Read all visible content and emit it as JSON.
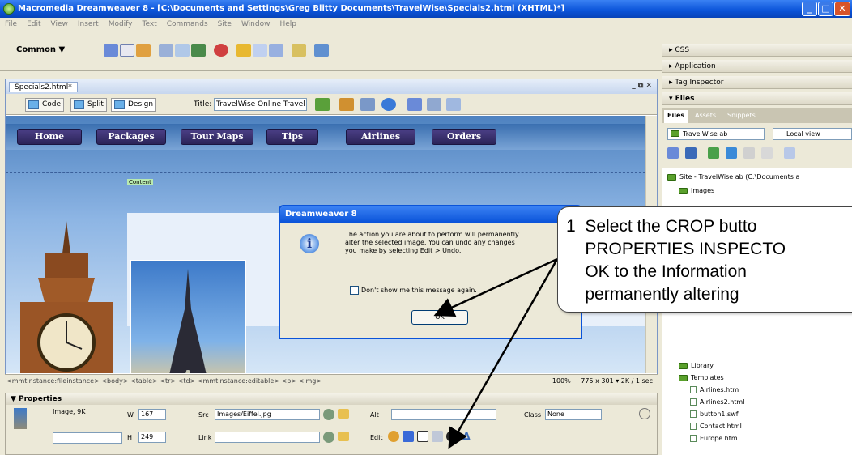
{
  "window": {
    "title": "Macromedia Dreamweaver 8 - [C:\\Documents and Settings\\Greg Blitty Documents\\TravelWise\\Specials2.html (XHTML)*]",
    "min": "_",
    "max": "□",
    "close": "✕"
  },
  "menu": [
    "File",
    "Edit",
    "View",
    "Insert",
    "Modify",
    "Text",
    "Commands",
    "Site",
    "Window",
    "Help"
  ],
  "insert_bar": {
    "category": "Common ▼"
  },
  "document": {
    "tab": "Specials2.html*",
    "controls": "_ ⧉ ✕",
    "view_buttons": [
      "Code",
      "Split",
      "Design"
    ],
    "title_label": "Title:",
    "title_value": "TravelWise Online Travel Serv"
  },
  "page": {
    "nav": [
      "Home",
      "Packages",
      "Tour Maps",
      "Tips",
      "Airlines",
      "Orders"
    ],
    "editable_label": "Content"
  },
  "dialog": {
    "title": "Dreamweaver 8",
    "close": "✕",
    "icon": "i",
    "message": [
      "The action you are about to perform will permanently",
      "alter the selected image. You can undo any changes",
      "you make by selecting Edit > Undo."
    ],
    "checkbox": "Don't show me this message again.",
    "ok": "OK"
  },
  "status": {
    "tag_path": "<mmtinstance:fileinstance> <body> <table> <tr> <td> <mmtinstance:editable> <p> <img>",
    "zoom": "100%",
    "size": "775 x 301 ▾ 2K / 1 sec"
  },
  "properties": {
    "header": "▼ Properties",
    "type": "Image, 9K",
    "w_label": "W",
    "w": "167",
    "h_label": "H",
    "h": "249",
    "src_label": "Src",
    "src": "Images/Eiffel.jpg",
    "alt_label": "Alt",
    "link_label": "Link",
    "edit_label": "Edit",
    "class_label": "Class",
    "class": "None"
  },
  "panels": {
    "groups": [
      "▸ CSS",
      "▸ Application",
      "▸ Tag Inspector",
      "▾ Files"
    ],
    "tabs": [
      "Files",
      "Assets",
      "Snippets"
    ],
    "site": "TravelWise ab",
    "view": "Local view",
    "tree": [
      {
        "label": "Site - TravelWise ab (C:\\Documents a",
        "kind": "folder"
      },
      {
        "label": "Images",
        "kind": "folder"
      },
      {
        "label": "Library",
        "kind": "folder"
      },
      {
        "label": "Templates",
        "kind": "folder"
      },
      {
        "label": "Airlines.htm",
        "kind": "file"
      },
      {
        "label": "Airlines2.html",
        "kind": "file"
      },
      {
        "label": "button1.swf",
        "kind": "file"
      },
      {
        "label": "Contact.html",
        "kind": "file"
      },
      {
        "label": "Europe.htm",
        "kind": "file"
      }
    ]
  },
  "callout": {
    "text": "1  Select the CROP butto\n    PROPERTIES INSPECTO\n    OK to the Information\n    permanently altering"
  }
}
